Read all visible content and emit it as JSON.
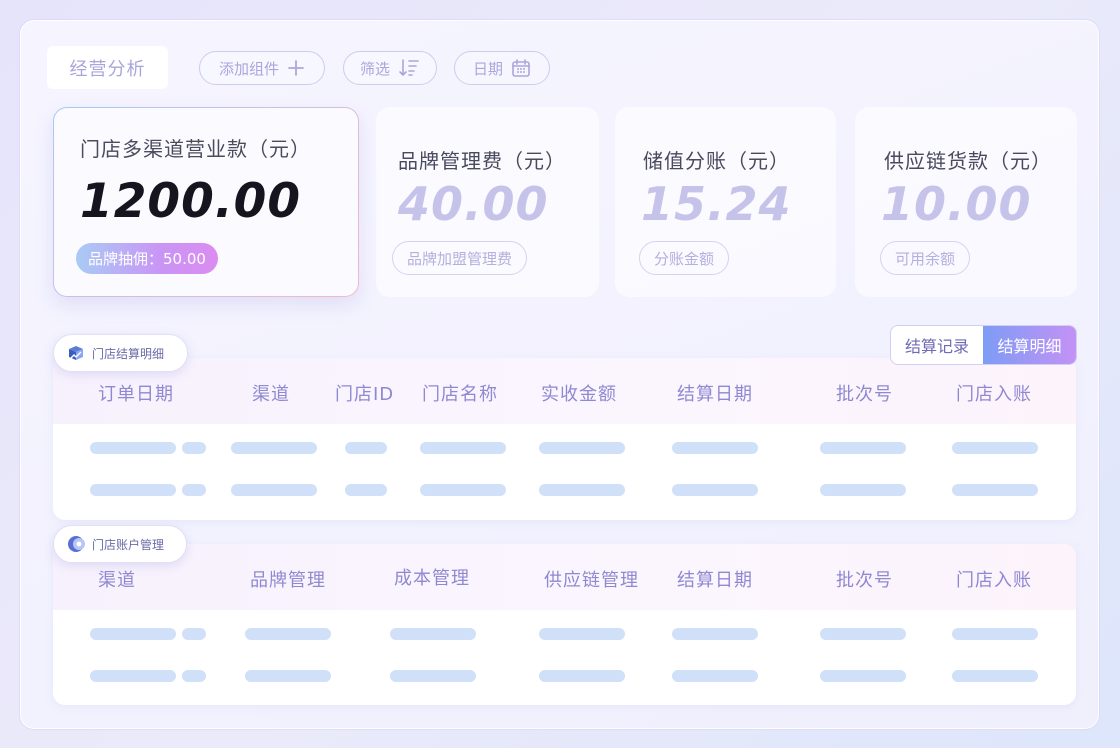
{
  "toolbar": {
    "title": "经营分析",
    "add_widget_label": "添加组件",
    "filter_label": "筛选",
    "date_label": "日期"
  },
  "cards": [
    {
      "label": "门店多渠道营业款（元）",
      "value": "1200.00",
      "pill": "品牌抽佣：50.00"
    },
    {
      "label": "品牌管理费（元）",
      "value": "40.00",
      "pill": "品牌加盟管理费"
    },
    {
      "label": "储值分账（元）",
      "value": "15.24",
      "pill": "分账金额"
    },
    {
      "label": "供应链货款（元）",
      "value": "10.00",
      "pill": "可用余额"
    }
  ],
  "settlement": {
    "tag": "门店结算明细",
    "toggle": [
      "结算记录",
      "结算明细"
    ],
    "columns": [
      "订单日期",
      "渠道",
      "门店ID",
      "门店名称",
      "实收金额",
      "结算日期",
      "批次号",
      "门店入账"
    ]
  },
  "accounts": {
    "tag": "门店账户管理",
    "columns": [
      "渠道",
      "品牌管理",
      "成本管理",
      "供应链管理",
      "结算日期",
      "批次号",
      "门店入账"
    ]
  },
  "colors": {
    "accent": "#8f89d1",
    "placeholder_bar": "#cfe0f8",
    "pill_gradient_start": "#a9cbf5",
    "pill_gradient_end": "#dc8cf0"
  }
}
